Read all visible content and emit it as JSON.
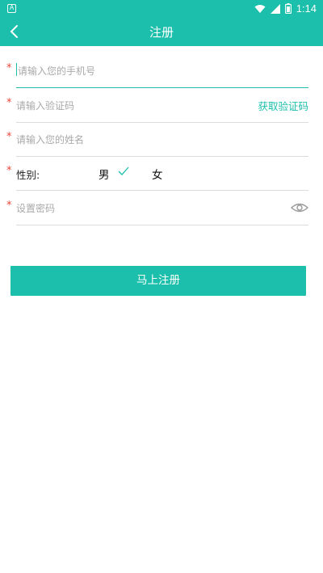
{
  "statusbar": {
    "time": "1:14",
    "left_icon": "A"
  },
  "header": {
    "title": "注册",
    "back_icon": "chevron-left-icon"
  },
  "form": {
    "required_mark": "*",
    "phone": {
      "placeholder": "请输入您的手机号"
    },
    "code": {
      "placeholder": "请输入验证码",
      "get_code_label": "获取验证码"
    },
    "name": {
      "placeholder": "请输入您的姓名"
    },
    "gender": {
      "label": "性别:",
      "male": "男",
      "female": "女",
      "selected": "男"
    },
    "password": {
      "placeholder": "设置密码",
      "toggle_icon": "eye-icon"
    }
  },
  "submit_label": "马上注册",
  "colors": {
    "accent": "#1cbfac",
    "required": "#e8473b",
    "placeholder": "#a9a9a9"
  }
}
